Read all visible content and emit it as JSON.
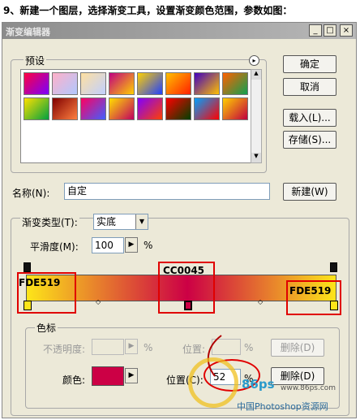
{
  "caption": "9、新建一个图层，选择渐变工具，设置渐变颜色范围，参数如图：",
  "window": {
    "title": "渐变编辑器",
    "min_glyph": "_",
    "max_glyph": "□",
    "close_glyph": "×"
  },
  "presets": {
    "label": "预设",
    "menu_glyph": "▸",
    "swatches": [
      [
        "#ff0040",
        "#7a00ff"
      ],
      [
        "#ffb0c8",
        "#b0c8ff"
      ],
      [
        "#ffe0a0",
        "#c0d0ff"
      ],
      [
        "#c00080",
        "#ffd000"
      ],
      [
        "#ffd000",
        "#2040ff"
      ],
      [
        "#ffc000",
        "#ff2000"
      ],
      [
        "#4000c0",
        "#ffc000"
      ],
      [
        "#ff6000",
        "#10a050"
      ],
      [
        "#ffe000",
        "#00a040"
      ],
      [
        "#800000",
        "#ff8040"
      ],
      [
        "#ff0060",
        "#4060ff"
      ],
      [
        "#ffe000",
        "#c00060"
      ],
      [
        "#8000ff",
        "#ff4000"
      ],
      [
        "#ff0000",
        "#004000"
      ],
      [
        "#00a0ff",
        "#ff0000"
      ],
      [
        "#ffd000",
        "#c00040"
      ]
    ]
  },
  "buttons": {
    "ok": "确定",
    "cancel": "取消",
    "load": "载入(L)...",
    "save": "存储(S)...",
    "new": "新建(W)",
    "delete_opacity": "删除(D)",
    "delete_color": "删除(D)"
  },
  "name": {
    "label": "名称(N):",
    "value": "自定"
  },
  "gradient": {
    "type_label": "渐变类型(T):",
    "type_value": "实底",
    "smooth_label": "平滑度(M):",
    "smooth_value": "100",
    "smooth_unit": "%",
    "colors": [
      "#FDE519",
      "#CC0045",
      "#FDE519"
    ],
    "stop_hex_left": "FDE519",
    "stop_hex_mid": "CC0045",
    "stop_hex_right": "FDE519"
  },
  "stops": {
    "legend": "色标",
    "opacity_label": "不透明度:",
    "opacity_unit": "%",
    "position_label_top": "位置:",
    "position_unit_top": "%",
    "color_label": "颜色:",
    "color_value": "#CC0045",
    "position_label": "位置(C):",
    "position_value": "52",
    "position_unit": "%"
  },
  "watermark": {
    "brand": "86ps",
    "url": "www.86ps.com",
    "text": "中国Photoshop资源网"
  },
  "colors": {
    "dialog_bg": "#ece9d8",
    "highlight": "#e00000"
  }
}
